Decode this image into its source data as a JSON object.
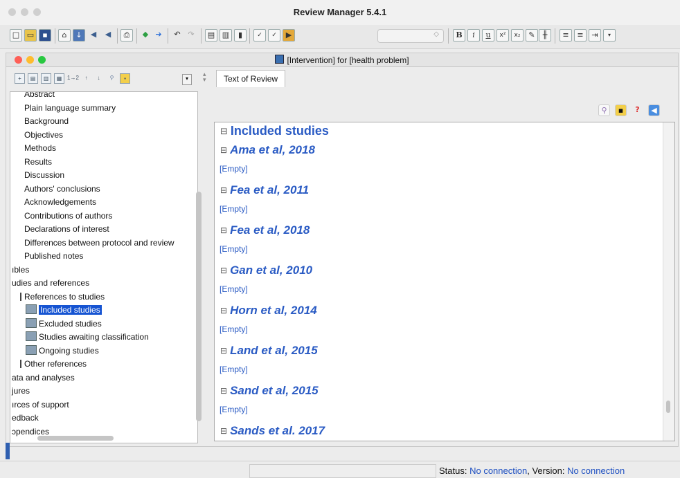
{
  "app": {
    "title": "Review Manager 5.4.1"
  },
  "document": {
    "title": "[Intervention] for [health problem]"
  },
  "tab": {
    "label": "Text of Review"
  },
  "tree": {
    "items": [
      {
        "label": "Abstract",
        "indent": 2,
        "icon": false
      },
      {
        "label": "Plain language summary",
        "indent": 2,
        "icon": false
      },
      {
        "label": "Background",
        "indent": 2,
        "icon": false
      },
      {
        "label": "Objectives",
        "indent": 2,
        "icon": false
      },
      {
        "label": "Methods",
        "indent": 2,
        "icon": false
      },
      {
        "label": "Results",
        "indent": 2,
        "icon": false
      },
      {
        "label": "Discussion",
        "indent": 2,
        "icon": false
      },
      {
        "label": "Authors' conclusions",
        "indent": 2,
        "icon": false
      },
      {
        "label": "Acknowledgements",
        "indent": 2,
        "icon": false
      },
      {
        "label": "Contributions of authors",
        "indent": 2,
        "icon": false
      },
      {
        "label": "Declarations of interest",
        "indent": 2,
        "icon": false
      },
      {
        "label": "Differences between protocol and review",
        "indent": 2,
        "icon": false
      },
      {
        "label": "Published notes",
        "indent": 2,
        "icon": false
      },
      {
        "label": "ıbles",
        "indent": 0,
        "icon": false
      },
      {
        "label": "udies and references",
        "indent": 0,
        "icon": false
      },
      {
        "label": "References to studies",
        "indent": 1,
        "icon": false
      },
      {
        "label": "Included studies",
        "indent": 3,
        "icon": true,
        "selected": true
      },
      {
        "label": "Excluded studies",
        "indent": 3,
        "icon": true
      },
      {
        "label": "Studies awaiting classification",
        "indent": 3,
        "icon": true
      },
      {
        "label": "Ongoing studies",
        "indent": 3,
        "icon": true
      },
      {
        "label": "Other references",
        "indent": 1,
        "icon": false
      },
      {
        "label": "ata and analyses",
        "indent": 0,
        "icon": false
      },
      {
        "label": "jures",
        "indent": 0,
        "icon": false
      },
      {
        "label": "ırces of support",
        "indent": 0,
        "icon": false
      },
      {
        "label": "edback",
        "indent": 0,
        "icon": false
      },
      {
        "label": "ɔpendices",
        "indent": 0,
        "icon": false
      }
    ]
  },
  "editor": {
    "heading": "Included studies",
    "empty_label": "[Empty]",
    "studies": [
      "Ama et al, 2018",
      "Fea et al, 2011",
      "Fea et al, 2018",
      "Gan et al, 2010",
      "Horn et al, 2014",
      "Land et al, 2015",
      "Sand et al, 2015",
      "Sands et al. 2017"
    ]
  },
  "status": {
    "status_label": "Status:",
    "status_value": "No connection",
    "version_label": "Version:",
    "version_value": "No connection",
    "separator": ","
  },
  "colors": {
    "accent": "#2a5bc4",
    "selection": "#1654d2"
  },
  "icons": {
    "toolbar": [
      "new-file-icon",
      "open-folder-icon",
      "save-icon",
      "home-icon",
      "import-icon",
      "back-arrow-icon",
      "back-icon",
      "print-icon",
      "go-back-icon",
      "go-forward-icon",
      "undo-icon",
      "redo-icon",
      "copy-icon",
      "paste-icon",
      "delete-icon",
      "spellcheck-icon",
      "spellcheck-options-icon",
      "spell-next-icon",
      "bold-icon",
      "italic-icon",
      "underline-icon",
      "superscript-icon",
      "subscript-icon",
      "highlight-icon",
      "special-char-icon",
      "bullet-list-icon",
      "numbered-list-icon",
      "indent-icon",
      "more-icon"
    ]
  }
}
